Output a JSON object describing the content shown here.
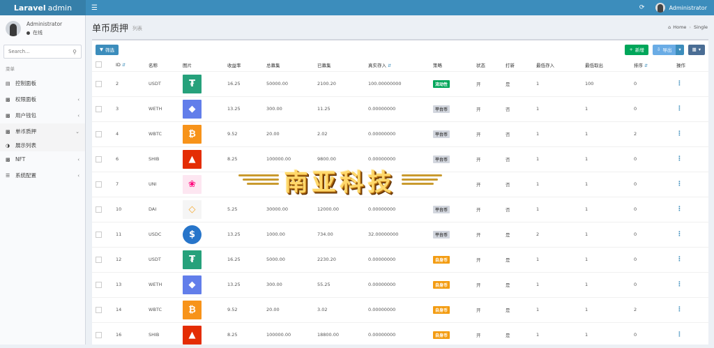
{
  "header": {
    "brand_bold": "Laravel",
    "brand_rest": "admin",
    "user_name": "Administrator"
  },
  "sidebar": {
    "user_name": "Administrator",
    "user_status": "在线",
    "search_placeholder": "Search...",
    "menu_header": "菜单",
    "items": [
      {
        "label": "控制面板",
        "icon": "chart-icon"
      },
      {
        "label": "权限面板",
        "icon": "briefcase-icon"
      },
      {
        "label": "用户钱包",
        "icon": "briefcase-icon"
      },
      {
        "label": "单币质押",
        "icon": "briefcase-icon"
      },
      {
        "label": "展示列表",
        "icon": "half-circle-icon"
      },
      {
        "label": "NFT",
        "icon": "briefcase-icon"
      },
      {
        "label": "系统配置",
        "icon": "bars-icon"
      }
    ]
  },
  "page": {
    "title": "单币质押",
    "subtitle": "列表",
    "breadcrumb_home": "Home",
    "breadcrumb_current": "Single"
  },
  "toolbar": {
    "filter_label": "筛选",
    "new_label": "新增",
    "export_label": "导出"
  },
  "table": {
    "columns": [
      "ID",
      "名称",
      "图片",
      "收益率",
      "总募集",
      "已募集",
      "真实存入",
      "策略",
      "状态",
      "打新",
      "最低存入",
      "最低取出",
      "排序",
      "操作"
    ],
    "rows": [
      {
        "id": "2",
        "name": "USDT",
        "coin": "tether",
        "rate": "16.25",
        "total": "50000.00",
        "raised": "2100.20",
        "real": "100.00000000",
        "strategy": "流动性",
        "strategy_color": "#00a65a",
        "status": "开",
        "ipo": "是",
        "min_in": "1",
        "min_out": "100",
        "sort": "0"
      },
      {
        "id": "3",
        "name": "WETH",
        "coin": "eth",
        "rate": "13.25",
        "total": "300.00",
        "raised": "11.25",
        "real": "0.00000000",
        "strategy": "平台币",
        "strategy_color": "#d2d6de",
        "status": "开",
        "ipo": "否",
        "min_in": "1",
        "min_out": "1",
        "sort": "0"
      },
      {
        "id": "4",
        "name": "WBTC",
        "coin": "btc",
        "rate": "9.52",
        "total": "20.00",
        "raised": "2.02",
        "real": "0.00000000",
        "strategy": "平台币",
        "strategy_color": "#d2d6de",
        "status": "开",
        "ipo": "否",
        "min_in": "1",
        "min_out": "1",
        "sort": "2"
      },
      {
        "id": "6",
        "name": "SHIB",
        "coin": "shib",
        "rate": "8.25",
        "total": "100000.00",
        "raised": "9800.00",
        "real": "0.00000000",
        "strategy": "平台币",
        "strategy_color": "#d2d6de",
        "status": "开",
        "ipo": "否",
        "min_in": "1",
        "min_out": "1",
        "sort": "0"
      },
      {
        "id": "7",
        "name": "UNI",
        "coin": "uni",
        "rate": "",
        "total": "",
        "raised": "",
        "real": "",
        "strategy": "",
        "strategy_color": "#d2d6de",
        "status": "开",
        "ipo": "否",
        "min_in": "1",
        "min_out": "1",
        "sort": "0"
      },
      {
        "id": "10",
        "name": "DAI",
        "coin": "dai",
        "rate": "5.25",
        "total": "30000.00",
        "raised": "12000.00",
        "real": "0.00000000",
        "strategy": "平台币",
        "strategy_color": "#d2d6de",
        "status": "开",
        "ipo": "否",
        "min_in": "1",
        "min_out": "1",
        "sort": "0"
      },
      {
        "id": "11",
        "name": "USDC",
        "coin": "usdc",
        "rate": "13.25",
        "total": "1000.00",
        "raised": "734.00",
        "real": "32.00000000",
        "strategy": "平台币",
        "strategy_color": "#d2d6de",
        "status": "开",
        "ipo": "是",
        "min_in": "2",
        "min_out": "1",
        "sort": "0"
      },
      {
        "id": "12",
        "name": "USDT",
        "coin": "tether",
        "rate": "16.25",
        "total": "5000.00",
        "raised": "2230.20",
        "real": "0.00000000",
        "strategy": "自身币",
        "strategy_color": "#f39c12",
        "status": "开",
        "ipo": "是",
        "min_in": "1",
        "min_out": "1",
        "sort": "0"
      },
      {
        "id": "13",
        "name": "WETH",
        "coin": "eth",
        "rate": "13.25",
        "total": "300.00",
        "raised": "55.25",
        "real": "0.00000000",
        "strategy": "自身币",
        "strategy_color": "#f39c12",
        "status": "开",
        "ipo": "是",
        "min_in": "1",
        "min_out": "1",
        "sort": "0"
      },
      {
        "id": "14",
        "name": "WBTC",
        "coin": "btc",
        "rate": "9.52",
        "total": "20.00",
        "raised": "3.02",
        "real": "0.00000000",
        "strategy": "自身币",
        "strategy_color": "#f39c12",
        "status": "开",
        "ipo": "是",
        "min_in": "1",
        "min_out": "1",
        "sort": "2"
      },
      {
        "id": "16",
        "name": "SHIB",
        "coin": "shib",
        "rate": "8.25",
        "total": "100000.00",
        "raised": "18800.00",
        "real": "0.00000000",
        "strategy": "自身币",
        "strategy_color": "#f39c12",
        "status": "开",
        "ipo": "是",
        "min_in": "1",
        "min_out": "1",
        "sort": "0"
      }
    ]
  },
  "watermark": {
    "text": "南亚科技"
  }
}
